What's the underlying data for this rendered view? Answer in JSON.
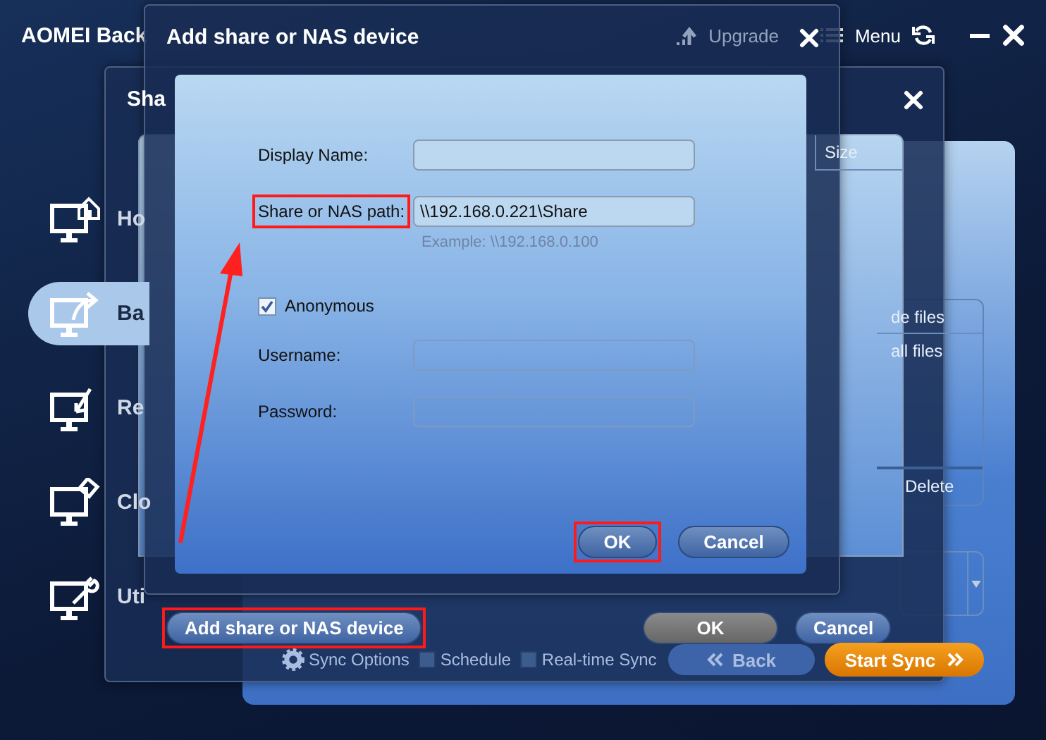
{
  "app": {
    "title": "AOMEI Back",
    "upgrade": "Upgrade",
    "menu": "Menu"
  },
  "sidebar": {
    "items": [
      {
        "label": "Ho",
        "kind": "home",
        "selected": false
      },
      {
        "label": "Ba",
        "kind": "backup",
        "selected": true
      },
      {
        "label": "Re",
        "kind": "restore",
        "selected": false
      },
      {
        "label": "Clo",
        "kind": "clone",
        "selected": false
      },
      {
        "label": "Uti",
        "kind": "tools",
        "selected": false
      }
    ]
  },
  "filter_box": {
    "items": [
      "de files",
      "all files"
    ],
    "button": "Delete"
  },
  "bottom_bar": {
    "options": "Sync Options",
    "checks": [
      {
        "label": "Schedule",
        "checked": false
      },
      {
        "label": "Real-time Sync",
        "checked": false
      }
    ],
    "back": "Back",
    "start": "Start Sync"
  },
  "share_dialog": {
    "title": "Sha",
    "columns": [
      "Size"
    ],
    "buttons": [
      {
        "label": "Add share or NAS device",
        "kind": "add",
        "highlighted": true
      },
      {
        "label": "OK",
        "kind": "ok",
        "highlighted": false
      },
      {
        "label": "Cancel",
        "kind": "cancel",
        "highlighted": false
      }
    ]
  },
  "nas_dialog": {
    "title": "Add share or NAS device",
    "fields": [
      {
        "kind": "text",
        "label": "Display Name:",
        "highlighted": false,
        "disabled": false
      },
      {
        "kind": "text",
        "label": "Share or NAS path:",
        "value": "\\\\192.168.0.221\\Share",
        "hint": "Example: \\\\192.168.0.100",
        "highlighted": true,
        "disabled": false
      },
      {
        "kind": "checkbox",
        "label": "Anonymous",
        "checked": true
      },
      {
        "kind": "text",
        "label": "Username:",
        "highlighted": false,
        "disabled": true
      },
      {
        "kind": "text",
        "label": "Password:",
        "highlighted": false,
        "disabled": true
      }
    ],
    "buttons": [
      {
        "label": "OK",
        "kind": "ok",
        "highlighted": true
      },
      {
        "label": "Cancel",
        "kind": "cancel",
        "highlighted": false
      }
    ]
  },
  "annotation_arrow": true
}
